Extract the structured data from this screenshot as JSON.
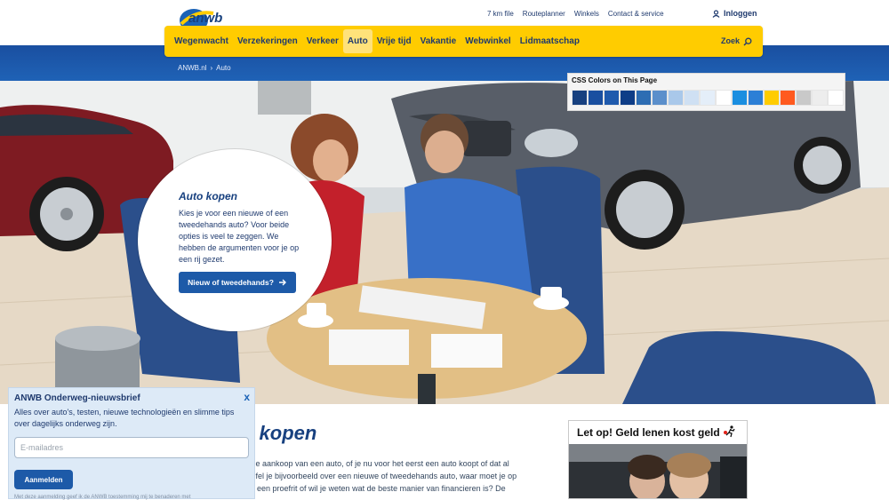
{
  "top_links": [
    "7 km file",
    "Routeplanner",
    "Winkels",
    "Contact & service"
  ],
  "login_label": "Inloggen",
  "nav": {
    "items": [
      "Wegenwacht",
      "Verzekeringen",
      "Verkeer",
      "Auto",
      "Vrije tijd",
      "Vakantie",
      "Webwinkel",
      "Lidmaatschap"
    ],
    "active": "Auto",
    "search_label": "Zoek"
  },
  "breadcrumb": [
    "ANWB.nl",
    "›",
    "Auto"
  ],
  "bubble": {
    "title": "Auto kopen",
    "text": "Kies je voor een nieuwe of een tweedehands auto? Voor beide opties is veel te zeggen. We hebben de argumenten voor je op een rij gezet.",
    "button_label": "Nieuw of tweedehands?"
  },
  "palette": {
    "title": "CSS Colors on This Page",
    "colors": [
      "#17407f",
      "#1a4fa0",
      "#1f5aad",
      "#0e3d87",
      "#2d6db3",
      "#5b8fcb",
      "#a9c8ea",
      "#cfe0f3",
      "#e4eef9",
      "#ffffff",
      "#1a8ee0",
      "#2c7fd6",
      "#ffcc00",
      "#ff5a1f",
      "#c9c9c9",
      "#ededed",
      "#ffffff"
    ]
  },
  "page_title": "o kopen",
  "intro_lines": [
    "er de aankoop van een auto, of je nu voor het eerst een auto koopt of dat al",
    "Twijfel je bijvoorbeeld over een nieuwe of tweedehands auto, waar moet je op",
    "van een proefrit of wil je weten wat de beste manier van financieren is? De"
  ],
  "ad_headline": "Let op! Geld lenen kost geld",
  "newsletter": {
    "title": "ANWB Onderweg-nieuwsbrief",
    "close_label": "x",
    "text": "Alles over auto's, testen, nieuwe technologieën en slimme tips over dagelijks onderweg zijn.",
    "placeholder": "E-mailadres",
    "button_label": "Aanmelden",
    "fine_print": "Met deze aanmelding geef ik de ANWB toestemming mij te benaderen met"
  }
}
